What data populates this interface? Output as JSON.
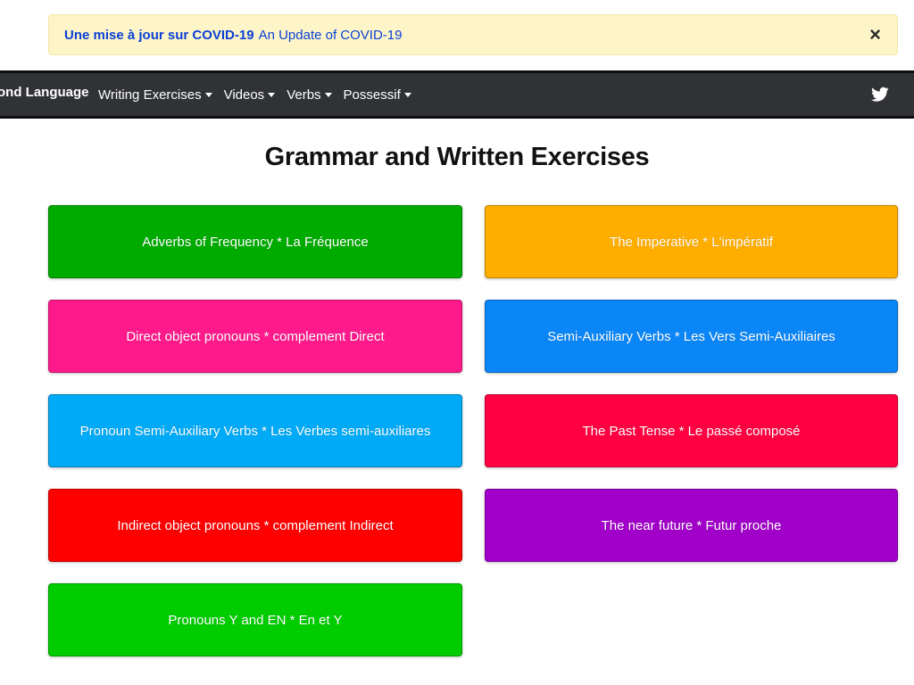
{
  "alert": {
    "text_fr": "Une mise à jour sur COVID-19",
    "text_en": "An Update of COVID-19",
    "close_label": "×"
  },
  "navbar": {
    "brand": "ond Language",
    "items": [
      {
        "label": "Writing Exercises"
      },
      {
        "label": "Videos"
      },
      {
        "label": "Verbs"
      },
      {
        "label": "Possessif"
      }
    ],
    "social_icon": "twitter-icon"
  },
  "main": {
    "title": "Grammar and Written Exercises",
    "cards": [
      {
        "label": "Adverbs of Frequency * La Fréquence",
        "color": "#00ab00"
      },
      {
        "label": "The Imperative * L'impératif",
        "color": "#ffae00"
      },
      {
        "label": "Direct object pronouns * complement Direct",
        "color": "#ff1a8c"
      },
      {
        "label": "Semi-Auxiliary Verbs * Les Vers Semi-Auxiliaires",
        "color": "#0a86f7"
      },
      {
        "label": "Pronoun Semi-Auxiliary Verbs * Les Verbes semi-auxiliares",
        "color": "#00aaf6"
      },
      {
        "label": "The Past Tense * Le passé composé",
        "color": "#ff0040"
      },
      {
        "label": "Indirect object pronouns * complement Indirect",
        "color": "#ff0000"
      },
      {
        "label": "The near future * Futur proche",
        "color": "#a000c8"
      },
      {
        "label": "Pronouns Y and EN * En et Y",
        "color": "#00cc00"
      }
    ]
  }
}
